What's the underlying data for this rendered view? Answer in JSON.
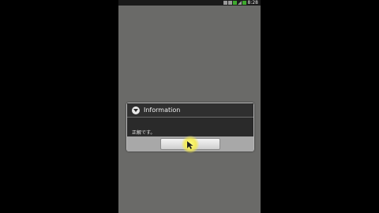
{
  "status_bar": {
    "time": "8:28",
    "icons": [
      "usb-icon",
      "notification-icon",
      "wifi-icon",
      "signal-icon",
      "battery-icon"
    ]
  },
  "dialog": {
    "title": "Information",
    "icon": "info-icon",
    "message": "正解です。",
    "button_label": ""
  },
  "colors": {
    "screen_background": "#6a6a68",
    "dialog_background": "#2a2a2a",
    "button_bar": "#a8a8a8",
    "touch_highlight": "#f5eb46"
  }
}
